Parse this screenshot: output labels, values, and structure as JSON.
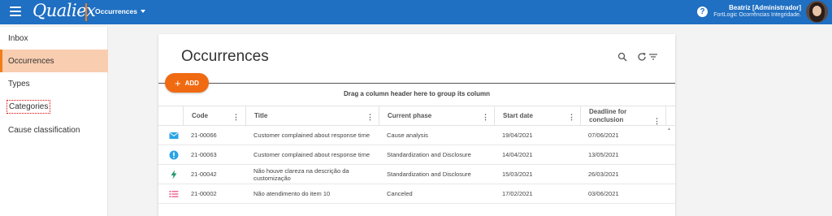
{
  "header": {
    "logo_text": "Qualiex",
    "module": "Occurrences",
    "user_name": "Beatriz [Administrador]",
    "user_company": "FortLogic Ocorrências Integridade.",
    "help_symbol": "?",
    "bar_color": "#1f6fc2",
    "accent_color": "#f07d1a"
  },
  "sidebar": {
    "items": [
      {
        "label": "Inbox"
      },
      {
        "label": "Occurrences",
        "active": true
      },
      {
        "label": "Types"
      },
      {
        "label": "Categories",
        "focused": true
      },
      {
        "label": "Cause classification"
      }
    ]
  },
  "main": {
    "title": "Occurrences",
    "add_label": "ADD",
    "add_symbol": "+",
    "group_hint": "Drag a column header here to group its column",
    "tools": [
      "search-icon",
      "refresh-icon",
      "filter-icon"
    ]
  },
  "table": {
    "columns": [
      "Code",
      "Title",
      "Current phase",
      "Start date",
      "Deadline for conclusion"
    ],
    "column_menu_symbol": "⋮",
    "rows": [
      {
        "icon": "mail-icon",
        "icon_color": "#29a3e6",
        "code": "21-00066",
        "title": "Customer complained about response time",
        "phase": "Cause analysis",
        "start": "19/04/2021",
        "deadline": "07/06/2021"
      },
      {
        "icon": "alert-icon",
        "icon_color": "#29a3e6",
        "code": "21-00063",
        "title": "Customer complained about response time",
        "phase": "Standardization and Disclosure",
        "start": "14/04/2021",
        "deadline": "13/05/2021"
      },
      {
        "icon": "bolt-icon",
        "icon_color": "#1f9a6a",
        "code": "21-00042",
        "title": "Não houve clareza na descrição da customização",
        "phase": "Standardization and Disclosure",
        "start": "15/03/2021",
        "deadline": "26/03/2021"
      },
      {
        "icon": "list-icon",
        "icon_color": "#e8457a",
        "code": "21-00002",
        "title": "Não atendimento do item 10",
        "phase": "Canceled",
        "start": "17/02/2021",
        "deadline": "03/06/2021"
      }
    ]
  }
}
